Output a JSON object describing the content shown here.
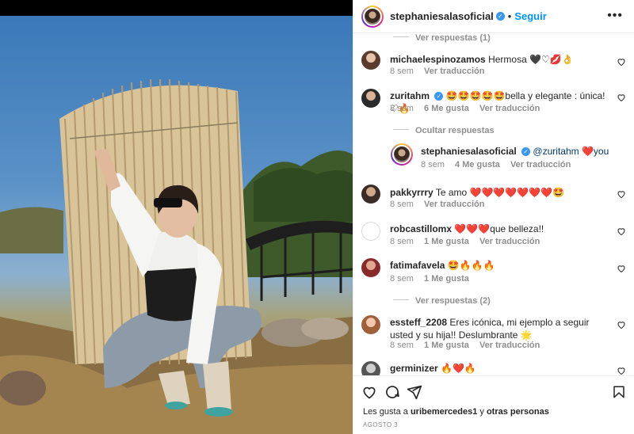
{
  "post": {
    "author": "stephaniesalasoficial",
    "follow_label": "Seguir",
    "dot": "•",
    "more_label": "•••"
  },
  "comments_section": {
    "top_toggle": "Ver respuestas (1)",
    "reply_label": "Ver traducción",
    "items": [
      {
        "user": "michaelespinozamos",
        "text": "Hermosa 🖤♡💋👌",
        "age": "8 sem",
        "likes": "",
        "translate": "Ver traducción"
      },
      {
        "user": "zuritahm",
        "text": "🤩🤩🤩🤩🤩bella y elegante : única! ♡🔥",
        "age": "8 sem",
        "likes": "6 Me gusta",
        "translate": "Ver traducción"
      },
      {
        "user": "pakkyrrry",
        "text": "Te amo ❤️❤️❤️❤️❤️❤️❤️🤩",
        "age": "8 sem",
        "likes": "",
        "translate": "Ver traducción"
      },
      {
        "user": "robcastillomx",
        "text": "❤️❤️❤️que belleza!!",
        "age": "8 sem",
        "likes": "1 Me gusta",
        "translate": "Ver traducción"
      },
      {
        "user": "fatimafavela",
        "text": "🤩🔥🔥🔥",
        "age": "8 sem",
        "likes": "1 Me gusta",
        "translate": ""
      },
      {
        "user": "essteff_2208",
        "text": "Eres icónica, mi ejemplo a seguir usted y su hija!! Deslumbrante 🌟",
        "age": "8 sem",
        "likes": "1 Me gusta",
        "translate": "Ver traducción"
      },
      {
        "user": "germinizer",
        "text": "🔥❤️🔥",
        "age": "",
        "likes": "",
        "translate": ""
      }
    ],
    "hide_replies": "Ocultar respuestas",
    "reply": {
      "user": "stephaniesalasoficial",
      "text": "@zuritahm ❤️you",
      "age": "8 sem",
      "likes": "4 Me gusta",
      "translate": "Ver traducción"
    },
    "fatima_toggle": "Ver respuestas (2)"
  },
  "footer": {
    "likes_prefix": "Les gusta a ",
    "likes_user": "uribemercedes1",
    "likes_mid": " y ",
    "likes_others": "otras personas",
    "date": "AGOSTO 3"
  },
  "colors": {
    "accent": "#0095f6",
    "verified": "#3897f0",
    "muted": "#8e8e8e",
    "text": "#262626"
  },
  "icons": [
    "heart-icon",
    "comment-icon",
    "share-icon",
    "bookmark-icon",
    "verified-badge-icon",
    "more-options-icon"
  ]
}
